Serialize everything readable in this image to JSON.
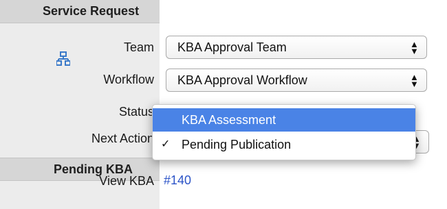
{
  "sections": {
    "service_request": "Service Request",
    "pending_kba": "Pending KBA"
  },
  "rows": {
    "team_label": "Team",
    "team_value": "KBA Approval Team",
    "workflow_label": "Workflow",
    "workflow_value": "KBA Approval Workflow",
    "status_label": "Status",
    "next_action_label": "Next Action",
    "view_kba_label": "View KBA",
    "view_kba_link": "#140"
  },
  "dropdown": {
    "highlighted": "KBA Assessment",
    "selected": "Pending Publication",
    "check": "✓"
  },
  "icons": {
    "workflow": "hierarchy-icon",
    "select_arrows": "up-down-arrows-icon"
  },
  "colors": {
    "highlight": "#4a83e6",
    "link": "#2b53c7",
    "icon": "#3a79c9"
  }
}
